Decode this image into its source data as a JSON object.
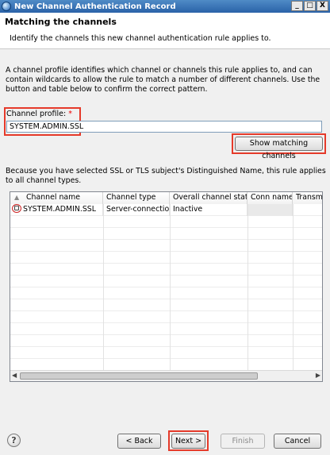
{
  "window": {
    "title": "New Channel Authentication Record",
    "min": "_",
    "max": "□",
    "close": "X"
  },
  "banner": {
    "title": "Matching the channels",
    "description": "Identify the channels this new channel authentication rule applies to."
  },
  "intro": "A channel profile identifies which channel or channels this rule applies to, and can contain wildcards to allow the rule to match a number of different channels. Use the button and table below to confirm the correct pattern.",
  "channel_profile": {
    "label": "Channel profile:",
    "required": "*",
    "value": "SYSTEM.ADMIN.SSL"
  },
  "show_matching_button": "Show matching channels",
  "info_text": "Because you have selected SSL or TLS subject's Distinguished Name, this rule applies to all channel types.",
  "table": {
    "columns": [
      "Channel name",
      "Channel type",
      "Overall channel status",
      "Conn name",
      "Transm"
    ],
    "rows": [
      {
        "name": "SYSTEM.ADMIN.SSL",
        "type": "Server-connection",
        "status": "Inactive",
        "conn": "",
        "xmit": ""
      }
    ]
  },
  "buttons": {
    "help": "?",
    "back": "< Back",
    "next": "Next >",
    "finish": "Finish",
    "cancel": "Cancel"
  },
  "colors": {
    "highlight": "#e53a2a",
    "title_bar": "#2a62a8"
  }
}
